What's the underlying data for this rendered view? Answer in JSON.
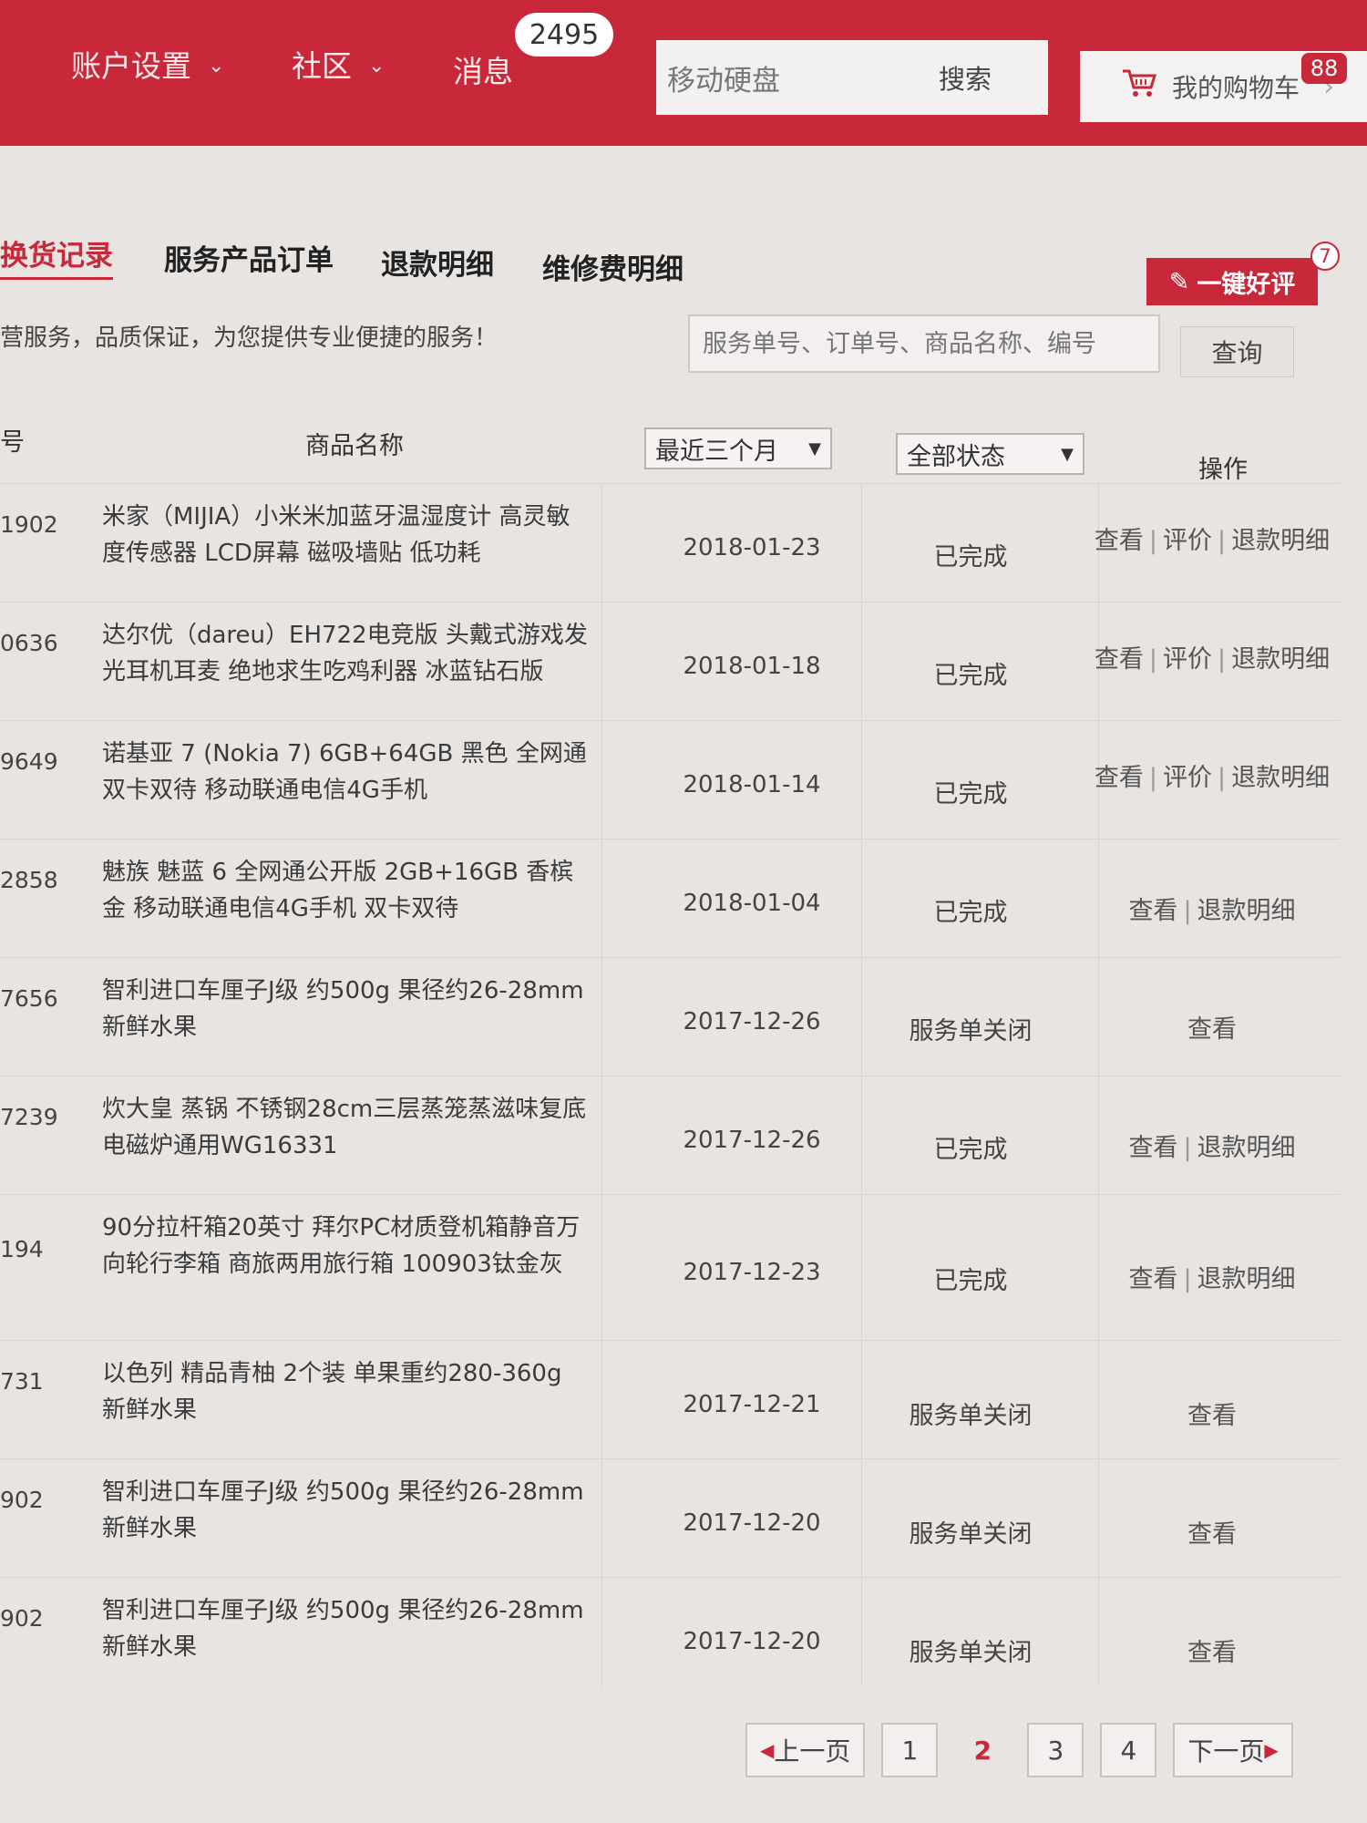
{
  "header": {
    "nav": [
      {
        "label": "账户设置"
      },
      {
        "label": "社区"
      },
      {
        "label": "消息"
      }
    ],
    "message_count": "2495",
    "search": {
      "value": "移动硬盘",
      "button": "搜索"
    },
    "cart": {
      "label": "我的购物车",
      "count": "88"
    }
  },
  "tabs": [
    {
      "label": "换货记录"
    },
    {
      "label": "服务产品订单"
    },
    {
      "label": "退款明细"
    },
    {
      "label": "维修费明细"
    }
  ],
  "review_button": {
    "label": "一键好评",
    "count": "7"
  },
  "slogan": "营服务，品质保证，为您提供专业便捷的服务！",
  "order_search": {
    "placeholder": "服务单号、订单号、商品名称、编号",
    "button": "查询"
  },
  "table": {
    "headers": {
      "id": "号",
      "name": "商品名称",
      "date_filter": "最近三个月",
      "status_filter": "全部状态",
      "ops": "操作"
    },
    "rows": [
      {
        "id": "1902",
        "name": "米家（MIJIA）小米米加蓝牙温湿度计 高灵敏度传感器 LCD屏幕 磁吸墙贴 低功耗",
        "date": "2018-01-23",
        "status": "已完成",
        "ops": [
          "查看",
          "评价",
          "退款明细"
        ]
      },
      {
        "id": "0636",
        "name": "达尔优（dareu）EH722电竞版 头戴式游戏发光耳机耳麦 绝地求生吃鸡利器 冰蓝钻石版",
        "date": "2018-01-18",
        "status": "已完成",
        "ops": [
          "查看",
          "评价",
          "退款明细"
        ]
      },
      {
        "id": "9649",
        "name": "诺基亚 7 (Nokia 7) 6GB+64GB 黑色 全网通 双卡双待 移动联通电信4G手机",
        "date": "2018-01-14",
        "status": "已完成",
        "ops": [
          "查看",
          "评价",
          "退款明细"
        ]
      },
      {
        "id": "2858",
        "name": "魅族 魅蓝 6 全网通公开版 2GB+16GB 香槟金 移动联通电信4G手机 双卡双待",
        "date": "2018-01-04",
        "status": "已完成",
        "ops": [
          "查看",
          "退款明细"
        ]
      },
      {
        "id": "7656",
        "name": "智利进口车厘子J级 约500g 果径约26-28mm 新鲜水果",
        "date": "2017-12-26",
        "status": "服务单关闭",
        "ops": [
          "查看"
        ]
      },
      {
        "id": "7239",
        "name": "炊大皇 蒸锅 不锈钢28cm三层蒸笼蒸滋味复底电磁炉通用WG16331",
        "date": "2017-12-26",
        "status": "已完成",
        "ops": [
          "查看",
          "退款明细"
        ]
      },
      {
        "id": "194",
        "name": "90分拉杆箱20英寸 拜尔PC材质登机箱静音万向轮行李箱 商旅两用旅行箱 100903钛金灰",
        "date": "2017-12-23",
        "status": "已完成",
        "ops": [
          "查看",
          "退款明细"
        ]
      },
      {
        "id": "731",
        "name": "以色列 精品青柚 2个装 单果重约280-360g 新鲜水果",
        "date": "2017-12-21",
        "status": "服务单关闭",
        "ops": [
          "查看"
        ]
      },
      {
        "id": "902",
        "name": "智利进口车厘子J级 约500g 果径约26-28mm 新鲜水果",
        "date": "2017-12-20",
        "status": "服务单关闭",
        "ops": [
          "查看"
        ]
      },
      {
        "id": "902",
        "name": "智利进口车厘子J级 约500g 果径约26-28mm 新鲜水果",
        "date": "2017-12-20",
        "status": "服务单关闭",
        "ops": [
          "查看"
        ]
      }
    ]
  },
  "pagination": {
    "prev": "上一页",
    "pages": [
      "1",
      "2",
      "3",
      "4"
    ],
    "current": "2",
    "next": "下一页"
  }
}
